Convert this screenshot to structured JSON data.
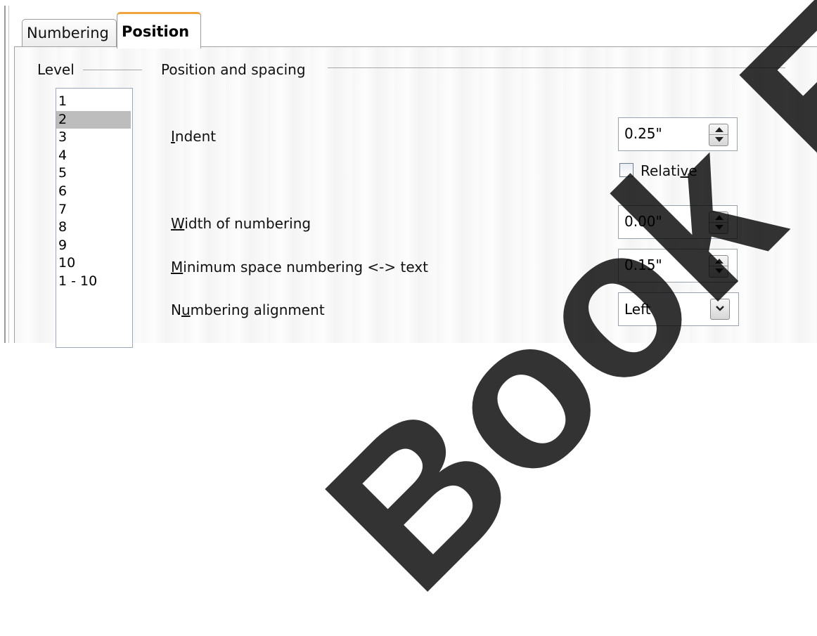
{
  "tabs": [
    {
      "label": "Numbering",
      "active": false
    },
    {
      "label": "Position",
      "active": true
    }
  ],
  "level": {
    "title": "Level",
    "items": [
      "1",
      "2",
      "3",
      "4",
      "5",
      "6",
      "7",
      "8",
      "9",
      "10",
      "1 - 10"
    ],
    "selected": "2"
  },
  "position_spacing": {
    "title": "Position and spacing",
    "indent": {
      "label_pre": "",
      "label_u": "I",
      "label_post": "ndent",
      "value": "0.25\""
    },
    "relative": {
      "label_pre": "Relati",
      "label_u": "v",
      "label_post": "e",
      "checked": false
    },
    "width": {
      "label_pre": "",
      "label_u": "W",
      "label_post": "idth of numbering",
      "value": "0.00\""
    },
    "min_space": {
      "label_pre": "",
      "label_u": "M",
      "label_post": "inimum space numbering <-> text",
      "value": "0.15\""
    },
    "alignment": {
      "label_pre": "N",
      "label_u": "u",
      "label_post": "mbering alignment",
      "value": "Left"
    }
  },
  "watermark": {
    "text": "Book Edi"
  },
  "colors": {
    "tab_accent": "#f0a53c",
    "selected_row": "#bdbdbd"
  },
  "icons": {
    "spin": "spin-up-down-icon",
    "dropdown": "chevron-down-icon"
  }
}
